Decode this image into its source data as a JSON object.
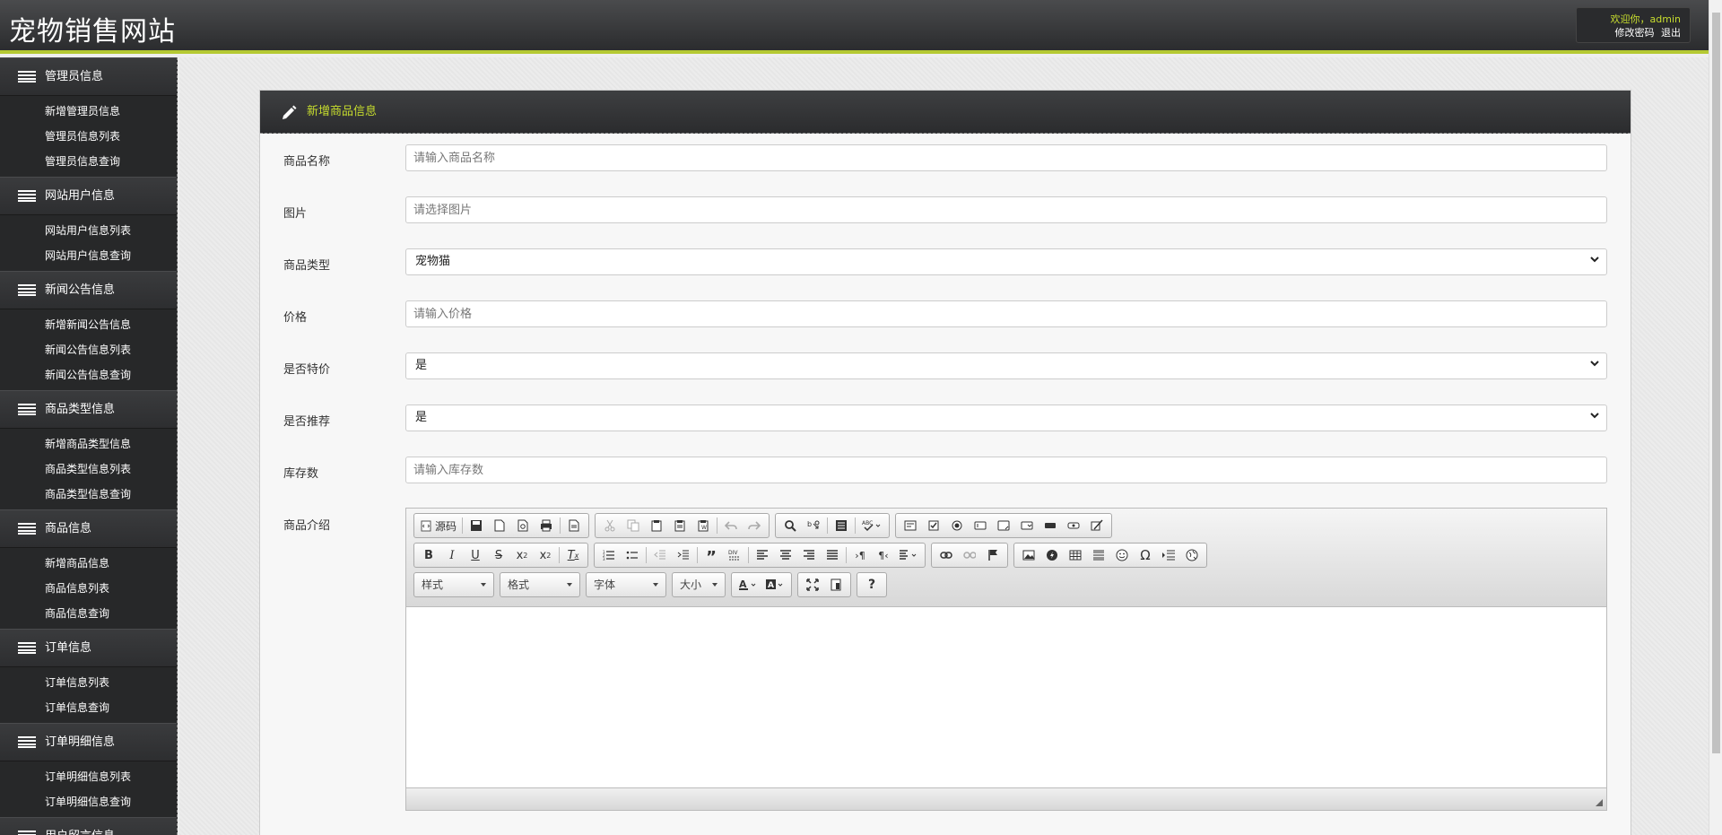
{
  "header": {
    "site_title": "宠物销售网站",
    "welcome": "欢迎你，admin",
    "change_password": "修改密码",
    "logout": "退出"
  },
  "sidebar": {
    "groups": [
      {
        "title": "管理员信息",
        "items": [
          "新增管理员信息",
          "管理员信息列表",
          "管理员信息查询"
        ]
      },
      {
        "title": "网站用户信息",
        "items": [
          "网站用户信息列表",
          "网站用户信息查询"
        ]
      },
      {
        "title": "新闻公告信息",
        "items": [
          "新增新闻公告信息",
          "新闻公告信息列表",
          "新闻公告信息查询"
        ]
      },
      {
        "title": "商品类型信息",
        "items": [
          "新增商品类型信息",
          "商品类型信息列表",
          "商品类型信息查询"
        ]
      },
      {
        "title": "商品信息",
        "items": [
          "新增商品信息",
          "商品信息列表",
          "商品信息查询"
        ]
      },
      {
        "title": "订单信息",
        "items": [
          "订单信息列表",
          "订单信息查询"
        ]
      },
      {
        "title": "订单明细信息",
        "items": [
          "订单明细信息列表",
          "订单明细信息查询"
        ]
      },
      {
        "title": "用户留言信息",
        "items": []
      }
    ]
  },
  "panel": {
    "title": "新增商品信息"
  },
  "form": {
    "name": {
      "label": "商品名称",
      "placeholder": "请输入商品名称"
    },
    "image": {
      "label": "图片",
      "placeholder": "请选择图片"
    },
    "type": {
      "label": "商品类型",
      "value": "宠物猫"
    },
    "price": {
      "label": "价格",
      "placeholder": "请输入价格"
    },
    "special": {
      "label": "是否特价",
      "value": "是"
    },
    "recommend": {
      "label": "是否推荐",
      "value": "是"
    },
    "stock": {
      "label": "库存数",
      "placeholder": "请输入库存数"
    },
    "description": {
      "label": "商品介绍"
    }
  },
  "editor": {
    "source_label": "源码",
    "combo_styles": "样式",
    "combo_format": "格式",
    "combo_font": "字体",
    "combo_size": "大小"
  },
  "colors": {
    "accent": "#c6dc2e",
    "header_bg": "#2b2c2e",
    "sidebar_bg": "#272829"
  }
}
